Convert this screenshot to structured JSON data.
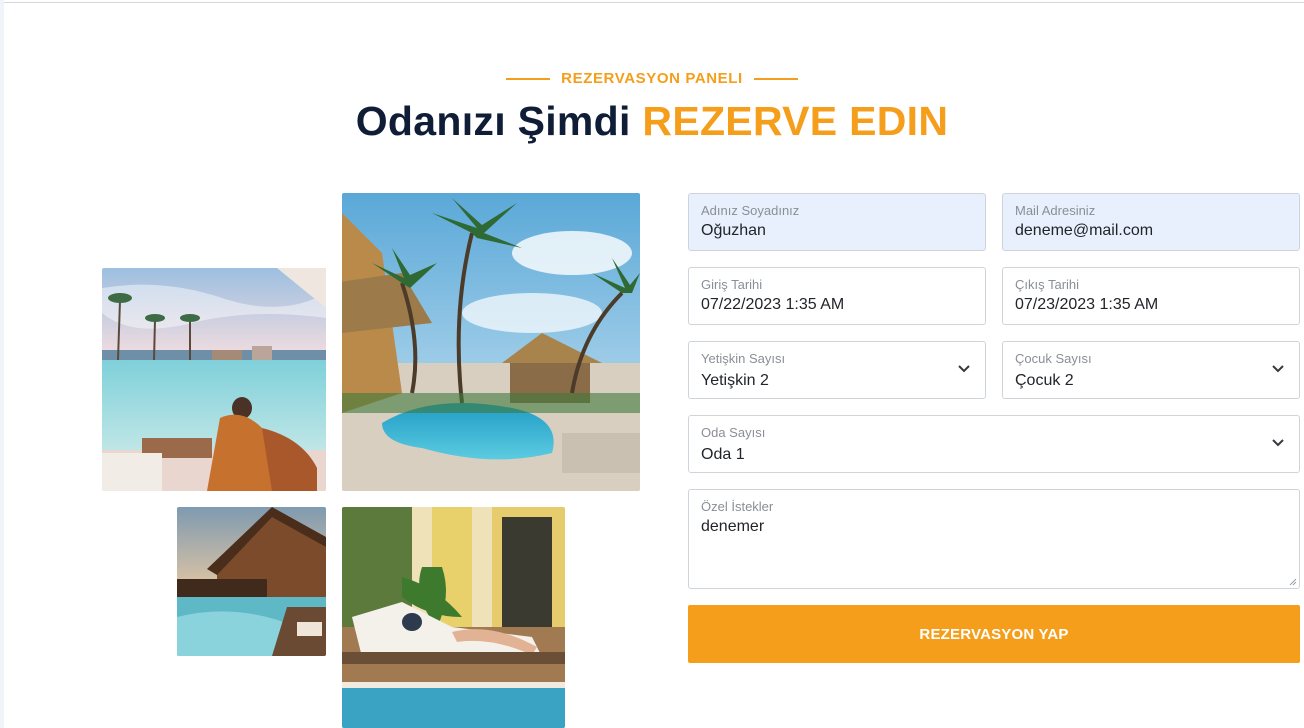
{
  "section": {
    "eyebrow": "REZERVASYON PANELI",
    "title_main": "Odanızı Şimdi",
    "title_accent": "REZERVE EDIN"
  },
  "photos": {
    "beach_pool": "beach-pool-photo",
    "resort_pool": "tropical-resort-pool-photo",
    "lodge_pool": "lodge-pool-photo",
    "lounger": "poolside-lounger-photo"
  },
  "form": {
    "name": {
      "label": "Adınız Soyadınız",
      "value": "Oğuzhan"
    },
    "email": {
      "label": "Mail Adresiniz",
      "value": "deneme@mail.com"
    },
    "checkin": {
      "label": "Giriş Tarihi",
      "value": "07/22/2023 1:35 AM"
    },
    "checkout": {
      "label": "Çıkış Tarihi",
      "value": "07/23/2023 1:35 AM"
    },
    "adults": {
      "label": "Yetişkin Sayısı",
      "value": "Yetişkin 2"
    },
    "children": {
      "label": "Çocuk Sayısı",
      "value": "Çocuk 2"
    },
    "rooms": {
      "label": "Oda Sayısı",
      "value": "Oda 1"
    },
    "requests": {
      "label": "Özel İstekler",
      "value": "denemer"
    },
    "submit_label": "REZERVASYON YAP"
  },
  "colors": {
    "accent": "#f59e1b",
    "heading": "#0f1e36",
    "autofill": "#e8f0fe"
  }
}
